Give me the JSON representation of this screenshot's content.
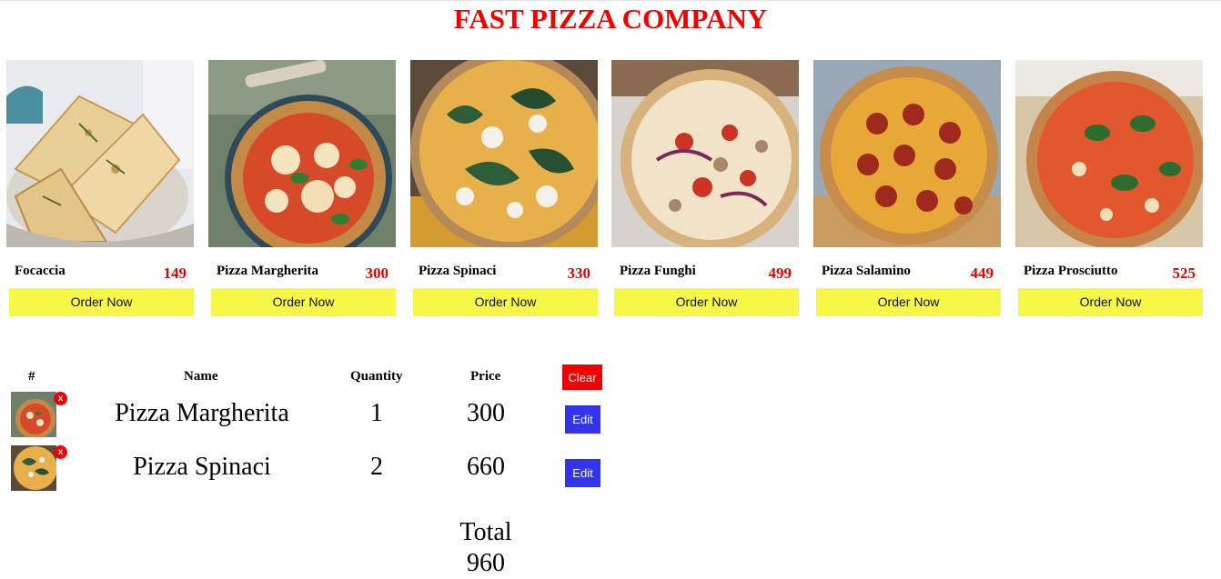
{
  "header": {
    "title": "FAST PIZZA COMPANY"
  },
  "products": [
    {
      "name": "Focaccia",
      "price": "149",
      "button": "Order Now"
    },
    {
      "name": "Pizza Margherita",
      "price": "300",
      "button": "Order Now"
    },
    {
      "name": "Pizza Spinaci",
      "price": "330",
      "button": "Order Now"
    },
    {
      "name": "Pizza Funghi",
      "price": "499",
      "button": "Order Now"
    },
    {
      "name": "Pizza Salamino",
      "price": "449",
      "button": "Order Now"
    },
    {
      "name": "Pizza Prosciutto",
      "price": "525",
      "button": "Order Now"
    }
  ],
  "cart": {
    "headers": {
      "index": "#",
      "name": "Name",
      "quantity": "Quantity",
      "price": "Price"
    },
    "clear_label": "Clear",
    "remove_label": "x",
    "edit_label": "Edit",
    "items": [
      {
        "name": "Pizza Margherita",
        "quantity": "1",
        "price": "300"
      },
      {
        "name": "Pizza Spinaci",
        "quantity": "2",
        "price": "660"
      }
    ],
    "total_label": "Total",
    "total_value": "960"
  },
  "colors": {
    "title": "#f00000",
    "price": "#e60000",
    "order_button": "#f7f747",
    "clear_button": "#f00000",
    "edit_button": "#3333ee"
  }
}
